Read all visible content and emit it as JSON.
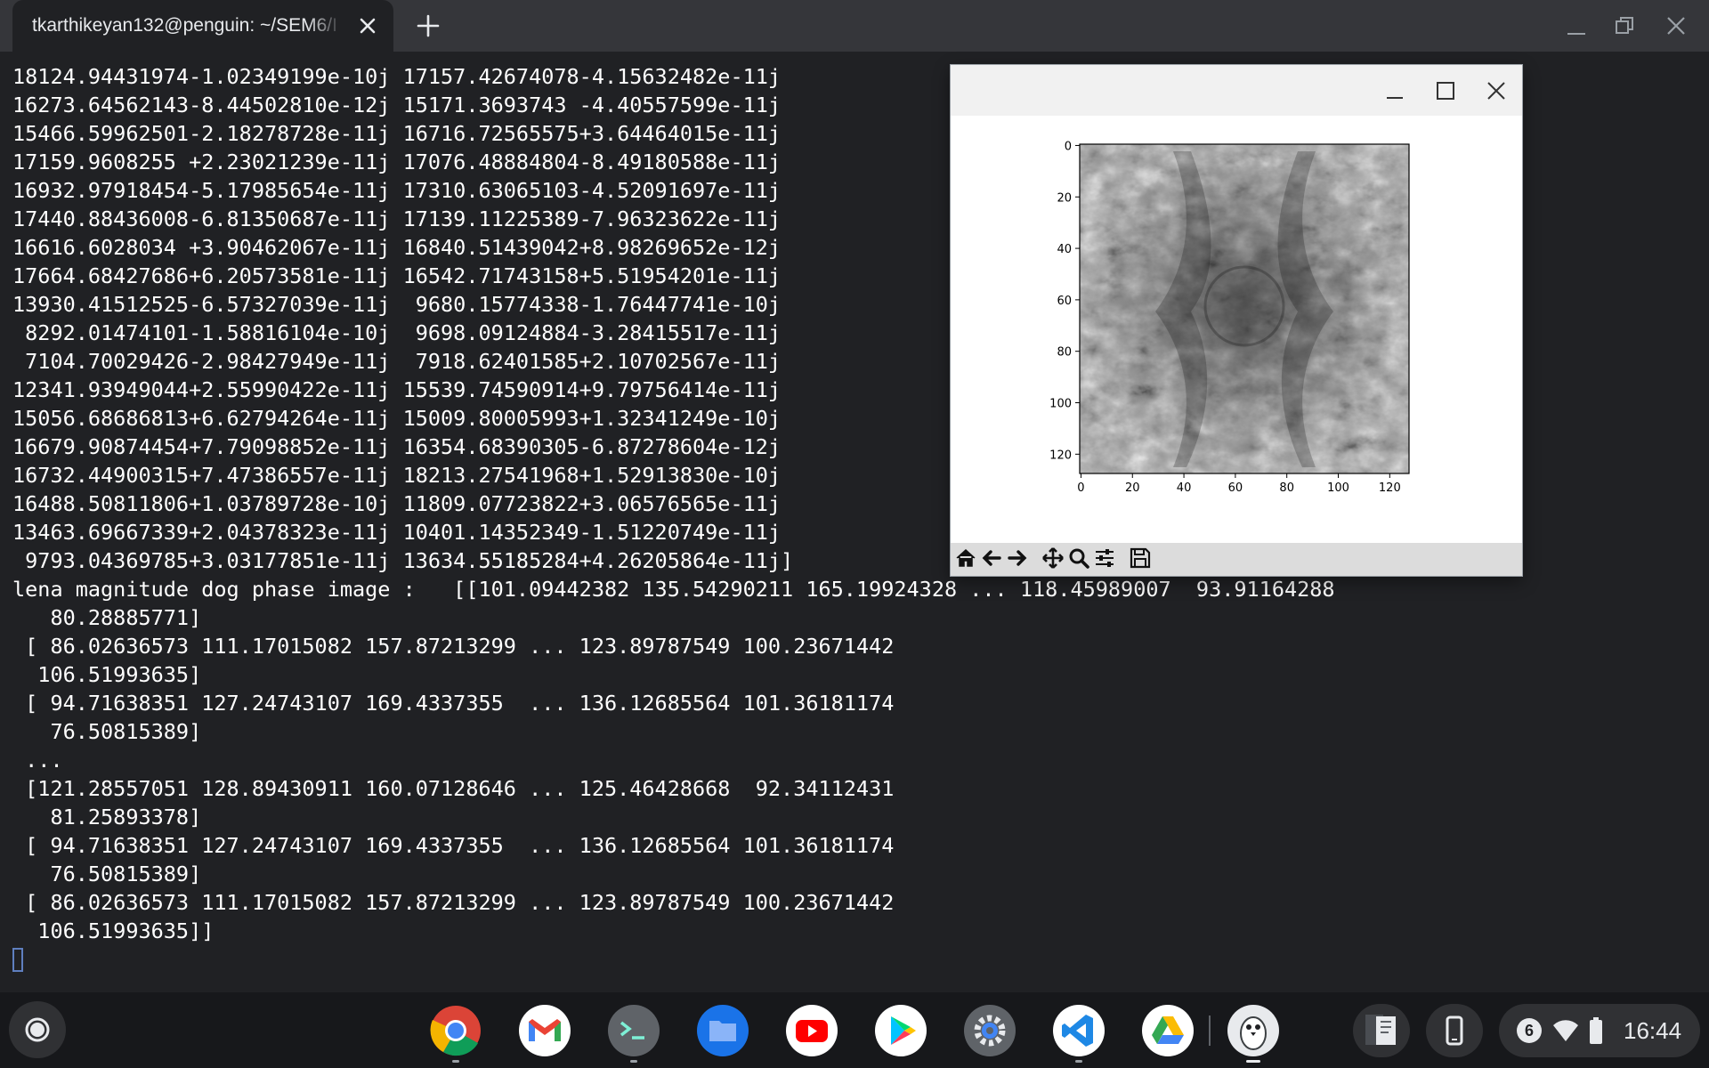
{
  "terminal_tab": {
    "title": "tkarthikeyan132@penguin: ~/SEM6/I"
  },
  "terminal": {
    "lines": [
      "18124.94431974-1.02349199e-10j 17157.42674078-4.15632482e-11j",
      "16273.64562143-8.44502810e-12j 15171.3693743 -4.40557599e-11j",
      "15466.59962501-2.18278728e-11j 16716.72565575+3.64464015e-11j",
      "17159.9608255 +2.23021239e-11j 17076.48884804-8.49180588e-11j",
      "16932.97918454-5.17985654e-11j 17310.63065103-4.52091697e-11j",
      "17440.88436008-6.81350687e-11j 17139.11225389-7.96323622e-11j",
      "16616.6028034 +3.90462067e-11j 16840.51439042+8.98269652e-12j",
      "17664.68427686+6.20573581e-11j 16542.71743158+5.51954201e-11j",
      "13930.41512525-6.57327039e-11j  9680.15774338-1.76447741e-10j",
      " 8292.01474101-1.58816104e-10j  9698.09124884-3.28415517e-11j",
      " 7104.70029426-2.98427949e-11j  7918.62401585+2.10702567e-11j",
      "12341.93949044+2.55990422e-11j 15539.74590914+9.79756414e-11j",
      "15056.68686813+6.62794264e-11j 15009.80005993+1.32341249e-10j",
      "16679.90874454+7.79098852e-11j 16354.68390305-6.87278604e-12j",
      "16732.44900315+7.47386557e-11j 18213.27541968+1.52913830e-10j",
      "16488.50811806+1.03789728e-10j 11809.07723822+3.06576565e-11j",
      "13463.69667339+2.04378323e-11j 10401.14352349-1.51220749e-11j",
      " 9793.04369785+3.03177851e-11j 13634.55185284+4.26205864e-11j]",
      "lena magnitude dog phase image :   [[101.09442382 135.54290211 165.19924328 ... 118.45989007  93.91164288",
      "   80.28885771]",
      " [ 86.02636573 111.17015082 157.87213299 ... 123.89787549 100.23671442",
      "  106.51993635]",
      " [ 94.71638351 127.24743107 169.4337355  ... 136.12685564 101.36181174",
      "   76.50815389]",
      " ...",
      " [121.28557051 128.89430911 160.07128646 ... 125.46428668  92.34112431",
      "   81.25893378]",
      " [ 94.71638351 127.24743107 169.4337355  ... 136.12685564 101.36181174",
      "   76.50815389]",
      " [ 86.02636573 111.17015082 157.87213299 ... 123.89787549 100.23671442",
      "  106.51993635]]"
    ]
  },
  "plot_window": {
    "chart_data": {
      "type": "heatmap",
      "colormap": "gray",
      "x_ticks": [
        "0",
        "20",
        "40",
        "60",
        "80",
        "100",
        "120"
      ],
      "y_ticks": [
        "0",
        "20",
        "40",
        "60",
        "80",
        "100",
        "120"
      ],
      "xlim": [
        0,
        127
      ],
      "ylim": [
        127,
        0
      ]
    }
  },
  "shelf": {
    "apps": [
      "Chrome",
      "Gmail",
      "Terminal",
      "Files",
      "YouTube",
      "Play Store",
      "Settings",
      "Visual Studio Code",
      "Google Drive",
      "Linux penguin"
    ],
    "notification_count": "6",
    "clock": "16:44"
  },
  "colors": {
    "terminal_bg": "#202124",
    "terminal_text": "#ffffff",
    "tabbar_bg": "#35363a",
    "shelf_bg": "#17181b"
  }
}
